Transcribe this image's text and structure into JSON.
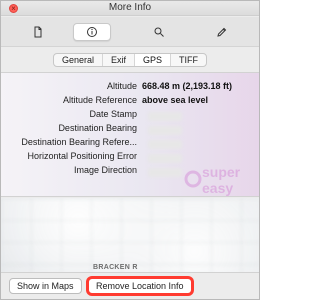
{
  "window": {
    "title": "More Info",
    "close_icon_glyph": "×"
  },
  "toolbar": {
    "tabs": [
      {
        "name": "document-icon",
        "active": false
      },
      {
        "name": "info-icon",
        "active": true
      },
      {
        "name": "search-icon",
        "active": false
      },
      {
        "name": "pencil-icon",
        "active": false
      }
    ]
  },
  "subtabs": {
    "items": [
      "General",
      "Exif",
      "GPS",
      "TIFF"
    ],
    "active": "GPS"
  },
  "metadata": {
    "rows": [
      {
        "label": "Altitude",
        "value": "668.48 m (2,193.18 ft)"
      },
      {
        "label": "Altitude Reference",
        "value": "above sea level"
      },
      {
        "label": "Date Stamp",
        "value": ""
      },
      {
        "label": "Destination Bearing",
        "value": ""
      },
      {
        "label": "Destination Bearing Refere...",
        "value": ""
      },
      {
        "label": "Horizontal Positioning Error",
        "value": ""
      },
      {
        "label": "Image Direction",
        "value": ""
      }
    ],
    "watermark_text_1": "super",
    "watermark_text_2": "easy"
  },
  "map": {
    "label": "BRACKEN R"
  },
  "buttons": {
    "show_in_maps": "Show in Maps",
    "remove_location_info": "Remove Location Info"
  },
  "colors": {
    "highlight_border": "#ff3b30",
    "close_button": "#ff5f57"
  }
}
